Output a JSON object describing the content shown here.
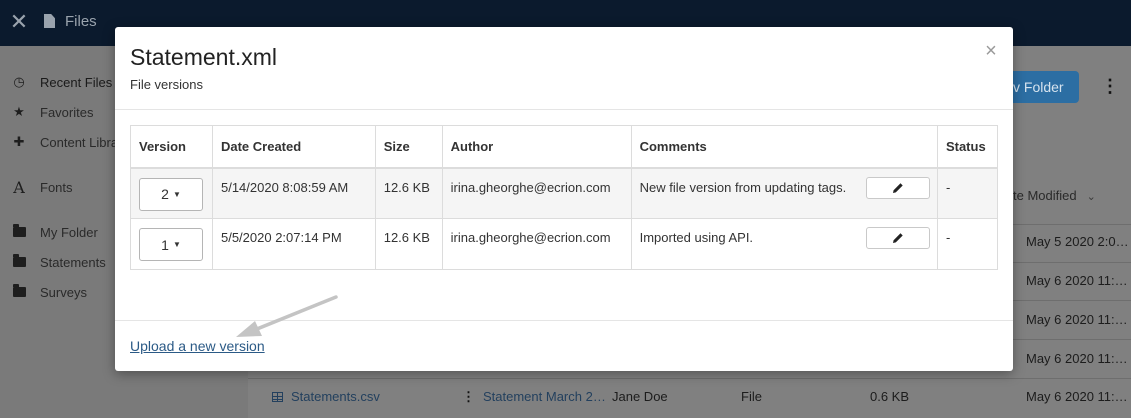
{
  "app": {
    "title": "Files",
    "new_folder_label": "v Folder",
    "sidebar": {
      "items": [
        {
          "label": "Recent Files",
          "icon": "clock-icon"
        },
        {
          "label": "Favorites",
          "icon": "star-icon"
        },
        {
          "label": "Content Libra",
          "icon": "puzzle-icon"
        },
        {
          "label": "Fonts",
          "icon": "font-icon"
        },
        {
          "label": "My Folder",
          "icon": "folder-icon"
        },
        {
          "label": "Statements",
          "icon": "folder-icon"
        },
        {
          "label": "Surveys",
          "icon": "folder-icon"
        }
      ]
    },
    "list": {
      "column_modified": "te Modified",
      "modified_values": [
        "May 5 2020 2:0…",
        "May 6 2020 11:…",
        "May 6 2020 11:…",
        "May 6 2020 11:…",
        "May 6 2020 11:…"
      ],
      "last_row": {
        "name": "Statements.csv",
        "description": "Statement March 2…",
        "owner": "Jane Doe",
        "type": "File",
        "size": "0.6 KB",
        "modified": "May 6 2020 11:…"
      }
    }
  },
  "modal": {
    "title": "Statement.xml",
    "subtitle": "File versions",
    "close_symbol": "×",
    "columns": [
      "Version",
      "Date Created",
      "Size",
      "Author",
      "Comments",
      "Status"
    ],
    "rows": [
      {
        "version": "2",
        "date": "5/14/2020 8:08:59 AM",
        "size": "12.6 KB",
        "author": "irina.gheorghe@ecrion.com",
        "comment": "New file version from updating tags.",
        "status": "-"
      },
      {
        "version": "1",
        "date": "5/5/2020 2:07:14 PM",
        "size": "12.6 KB",
        "author": "irina.gheorghe@ecrion.com",
        "comment": "Imported using API.",
        "status": "-"
      }
    ],
    "upload_link": "Upload a new version"
  }
}
